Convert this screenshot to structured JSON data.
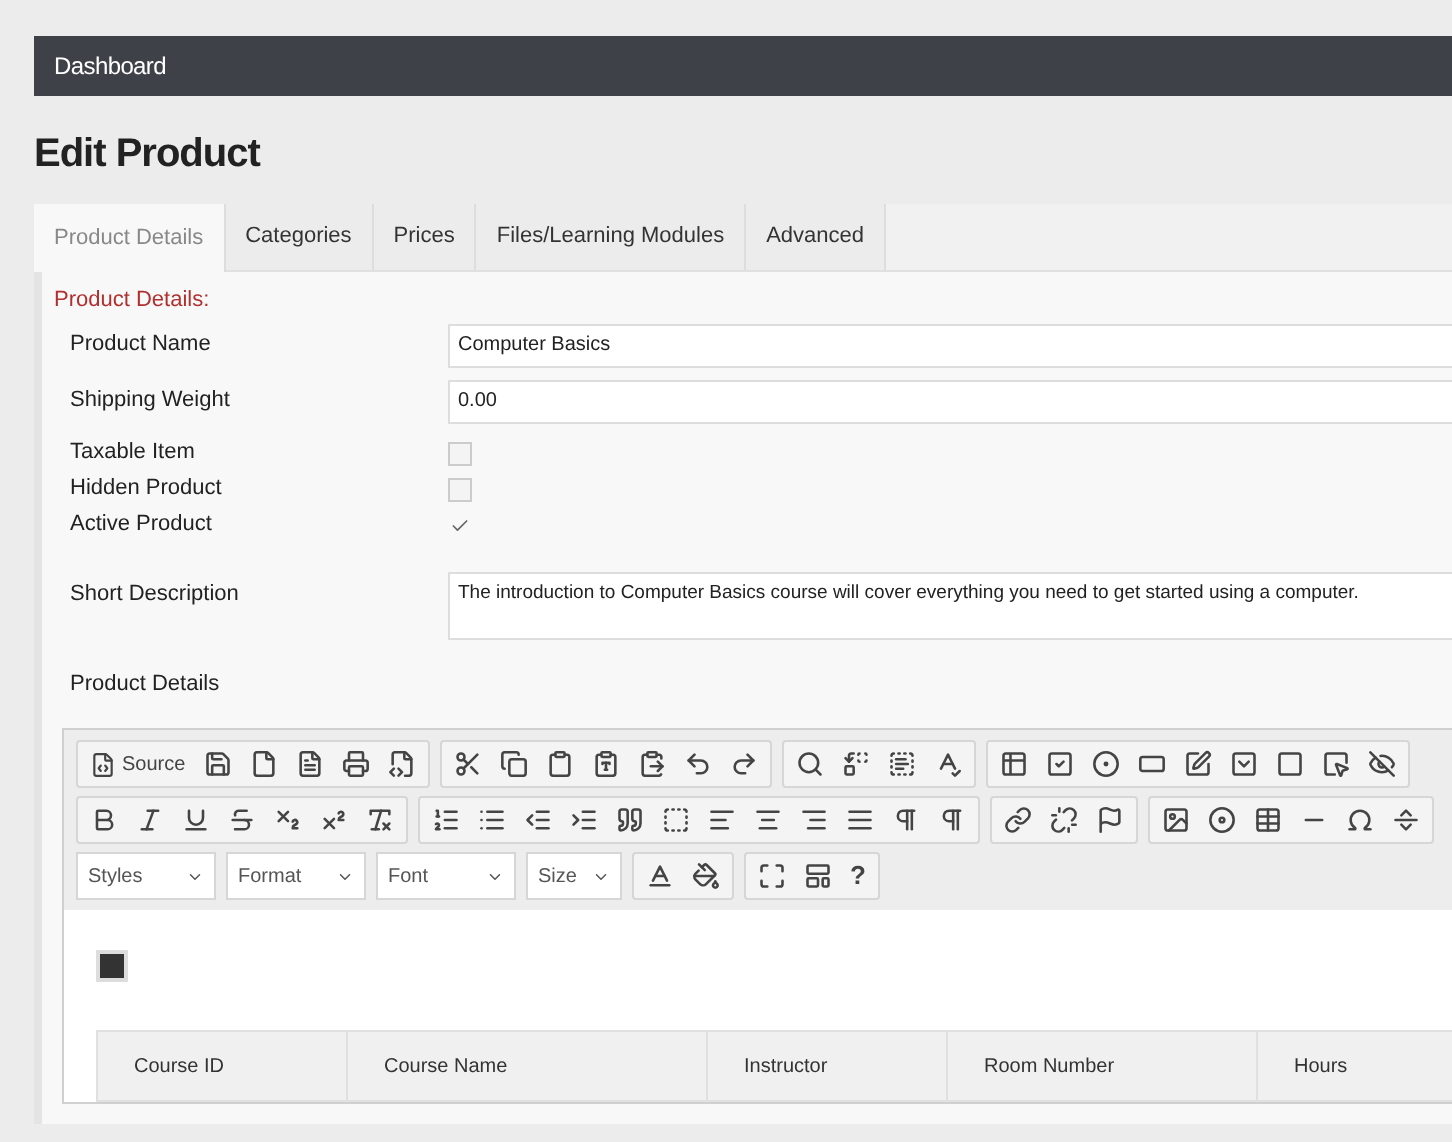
{
  "header": {
    "title": "Dashboard"
  },
  "page_title": "Edit Product",
  "tabs": [
    {
      "label": "Product Details",
      "selected": true
    },
    {
      "label": "Categories",
      "selected": false
    },
    {
      "label": "Prices",
      "selected": false
    },
    {
      "label": "Files/Learning Modules",
      "selected": false
    },
    {
      "label": "Advanced",
      "selected": false
    }
  ],
  "section_title": "Product Details:",
  "fields": [
    {
      "label": "Product Name",
      "value": "Computer Basics"
    },
    {
      "label": "Shipping Weight",
      "value": "0.00"
    }
  ],
  "checkboxes": [
    {
      "label": "Taxable Item",
      "checked": false
    },
    {
      "label": "Hidden Product",
      "checked": false
    },
    {
      "label": "Active Product",
      "checked": true
    }
  ],
  "short_description": {
    "label": "Short Description",
    "value": "The introduction to Computer Basics course will cover everything you need to get started using a computer."
  },
  "details_label": "Product Details",
  "editor": {
    "source_label": "Source",
    "combos": [
      "Styles",
      "Format",
      "Font",
      "Size"
    ],
    "help": "?",
    "table_columns": [
      "Course ID",
      "Course Name",
      "Instructor",
      "Room Number",
      "Hours"
    ]
  }
}
